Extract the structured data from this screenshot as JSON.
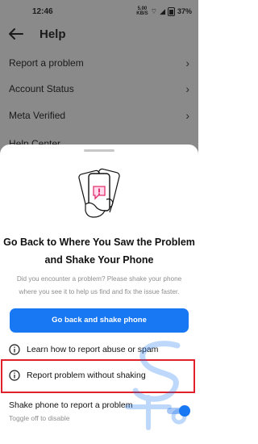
{
  "status_bar": {
    "time": "12:46",
    "data_speed_value": "5.00",
    "data_speed_unit": "KB/S",
    "battery": "37%",
    "icons": [
      "wifi-icon",
      "signal-icon",
      "battery-icon"
    ]
  },
  "header": {
    "title": "Help",
    "back_icon": "arrow-left-icon"
  },
  "menu": {
    "items": [
      {
        "label": "Report a problem"
      },
      {
        "label": "Account Status"
      },
      {
        "label": "Meta Verified"
      },
      {
        "label": "Help Center"
      }
    ],
    "chevron_glyph": "›"
  },
  "sheet": {
    "title_line1": "Go Back to Where You Saw the Problem",
    "title_line2": "and Shake Your Phone",
    "description_line1": "Did you encounter a problem? Please shake your phone",
    "description_line2": "where you see it to help us find and fix the issue faster.",
    "primary_button": "Go back and shake phone",
    "options": [
      {
        "label": "Learn how to report abuse or spam",
        "icon": "info-circle-icon"
      },
      {
        "label": "Report problem without shaking",
        "icon": "info-circle-icon"
      }
    ],
    "shake_toggle": {
      "label": "Shake phone to report a problem",
      "sublabel": "Toggle off to disable",
      "enabled": true
    }
  },
  "colors": {
    "accent": "#1877f2",
    "highlight": "#e0202b",
    "dim_overlay": "#8a8a8a"
  }
}
